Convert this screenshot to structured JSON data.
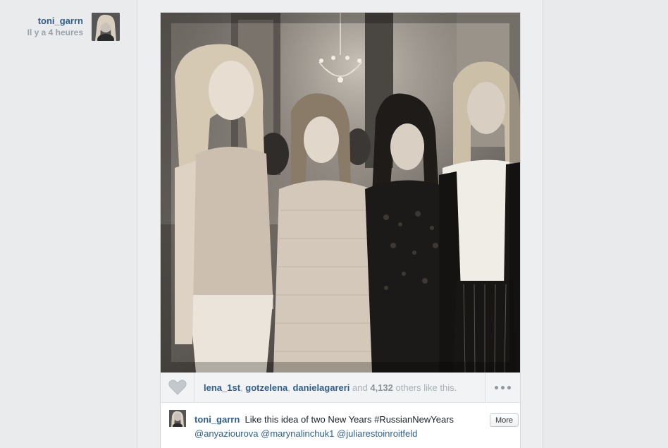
{
  "post": {
    "author": {
      "username": "toni_garrn",
      "time": "Il y a 4 heures",
      "avatar_icon": "profile-photo"
    },
    "likes": {
      "users": [
        "lena_1st",
        "gotzelena",
        "danielagareri"
      ],
      "sep1": ", ",
      "sep2": ", ",
      "and_text": " and ",
      "count": "4,132",
      "others_text": " others like this."
    },
    "caption": {
      "username": "toni_garrn",
      "text": "Like this idea of two New Years #RussianNewYears",
      "mentions": [
        "@anyaziourova",
        "@marynalinchuk1",
        "@juliarestoinroitfeld"
      ]
    },
    "more_button": "More",
    "icons": {
      "like": "heart-icon",
      "options": "ellipsis-icon"
    }
  }
}
